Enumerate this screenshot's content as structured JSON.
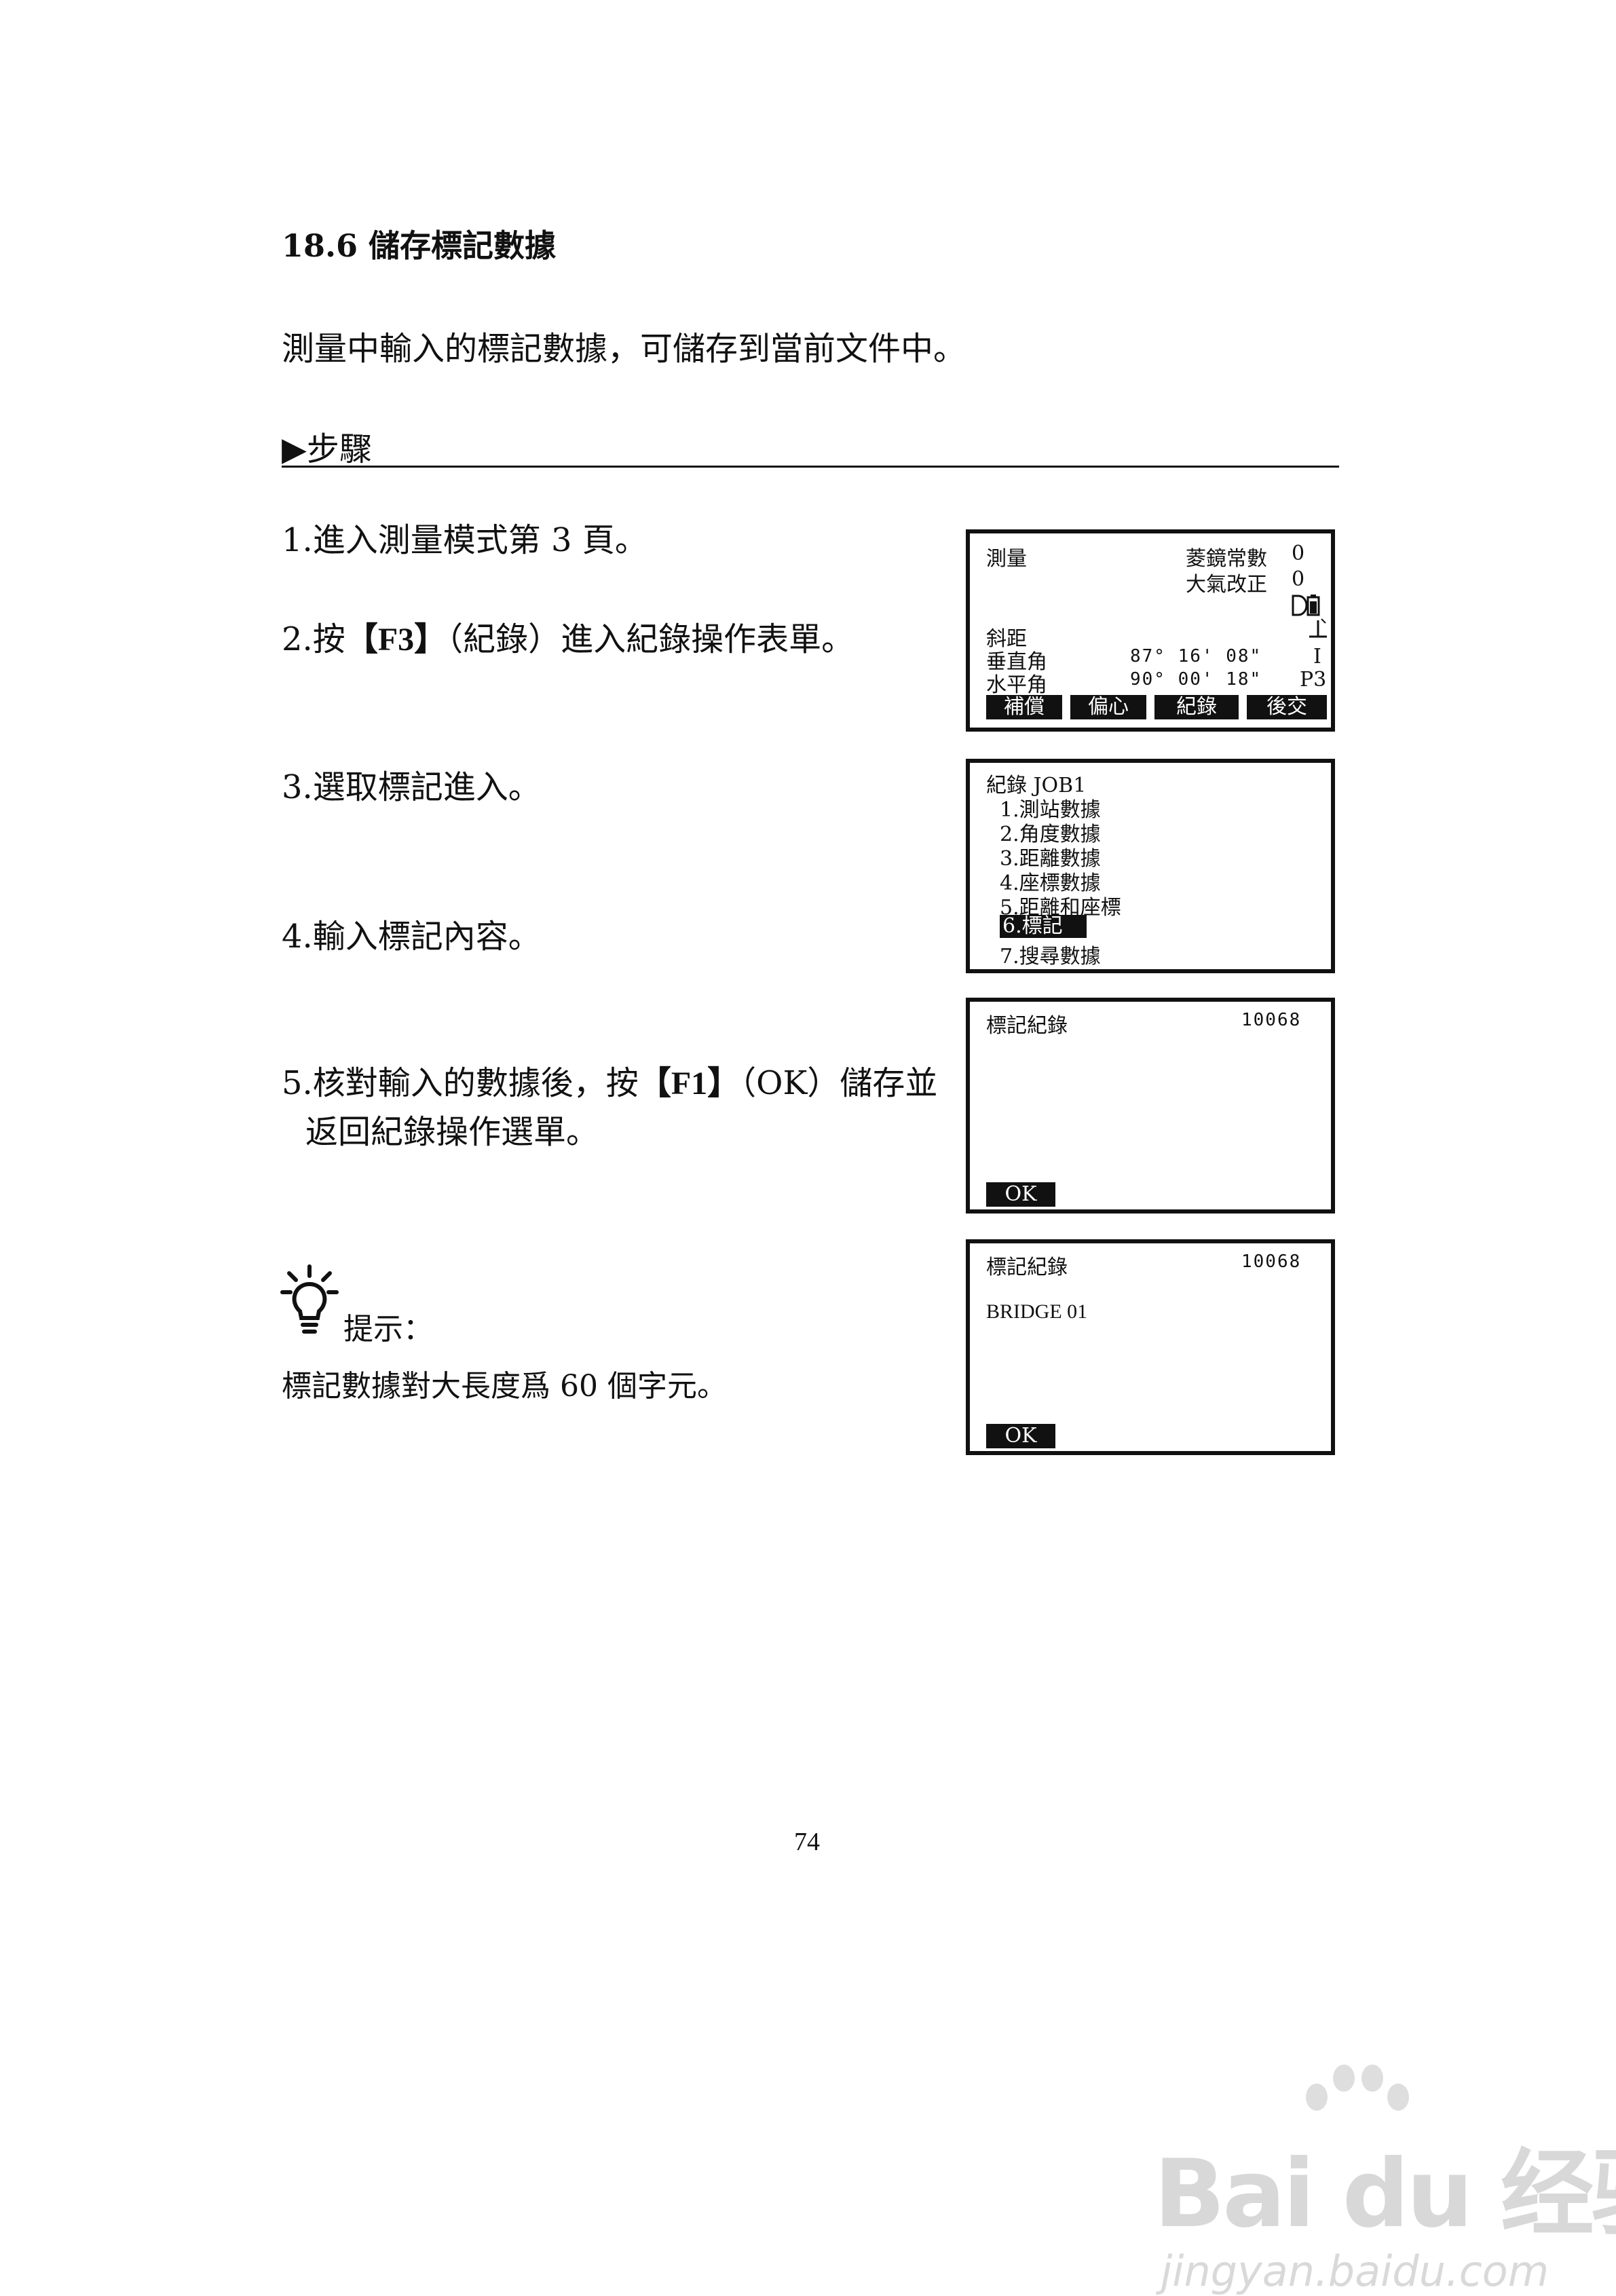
{
  "section": {
    "title": "18.6  儲存標記數據"
  },
  "intro": "測量中輸入的標記數據，可儲存到當前文件中。",
  "steps_heading": "▶步驟",
  "steps": {
    "s1": "1.進入測量模式第 3 頁。",
    "s2_pre": "2.按",
    "s2_key": "【F3】",
    "s2_post": "（紀錄）進入紀錄操作表單。",
    "s3": "3.選取標記進入。",
    "s4": "4.輸入標記內容。",
    "s5_pre": "5.核對輸入的數據後，按",
    "s5_key": "【F1】",
    "s5_post": "（OK）儲存並",
    "s5_line2": "返回紀錄操作選單。"
  },
  "hint": {
    "label": "提示：",
    "text": "標記數據對大長度爲 60 個字元。"
  },
  "screen1": {
    "title": "測量",
    "prism_label": "菱鏡常數",
    "prism_value": "0",
    "atm_label": "大氣改正",
    "atm_value": "0",
    "slope_label": "斜距",
    "vert_label": "垂直角",
    "vert_value": "87° 16' 08\"",
    "vert_flag": "I",
    "horiz_label": "水平角",
    "horiz_value": "90° 00' 18\"",
    "page": "P3",
    "softkeys": [
      "補償",
      "偏心",
      "紀錄",
      "後交"
    ]
  },
  "screen2": {
    "title": "紀錄  JOB1",
    "items": [
      "1.測站數據",
      "2.角度數據",
      "3.距離數據",
      "4.座標數據",
      "5.距離和座標",
      "6.標記",
      "7.搜尋數據"
    ]
  },
  "screen3": {
    "title": "標記紀錄",
    "number": "10068",
    "softkey": "OK"
  },
  "screen4": {
    "title": "標記紀錄",
    "number": "10068",
    "content": "BRIDGE 01",
    "softkey": "OK"
  },
  "page_number": "74",
  "watermark": {
    "brand": "Bai du 经验",
    "url": "jingyan.baidu.com"
  }
}
